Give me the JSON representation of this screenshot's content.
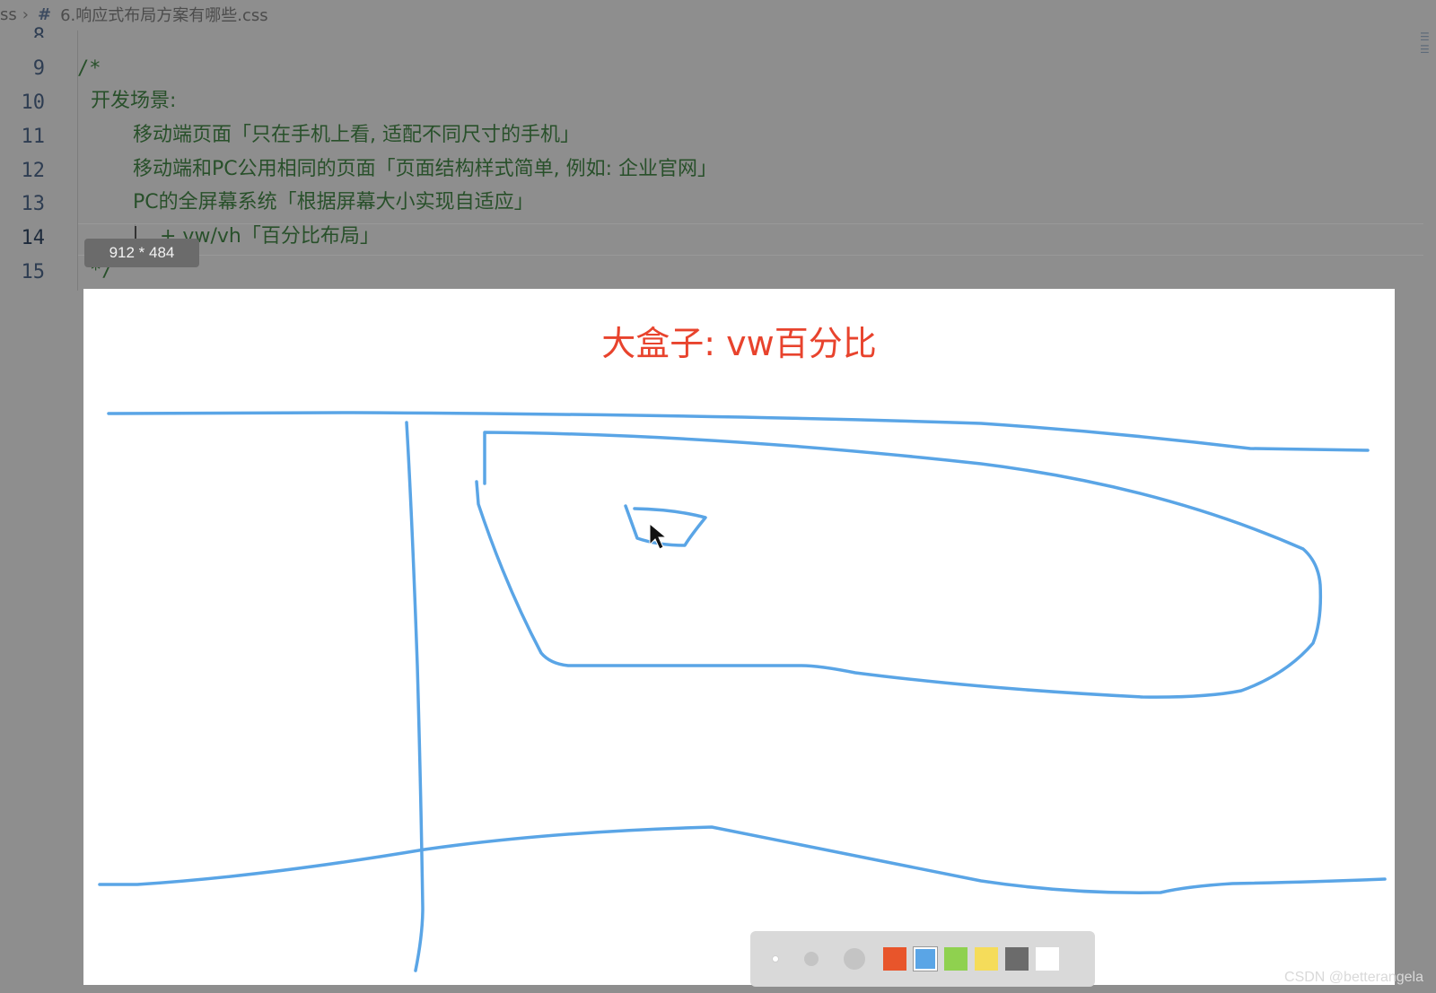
{
  "breadcrumb": {
    "parent": "ss",
    "file_icon": "#",
    "file_name": "6.响应式布局方案有哪些.css"
  },
  "editor": {
    "lines": [
      {
        "number": "8",
        "text": ""
      },
      {
        "number": "9",
        "text": "/*"
      },
      {
        "number": "10",
        "text": "开发场景:"
      },
      {
        "number": "11",
        "text": "移动端页面「只在手机上看, 适配不同尺寸的手机」"
      },
      {
        "number": "12",
        "text": "移动端和PC公用相同的页面「页面结构样式简单, 例如: 企业官网」"
      },
      {
        "number": "13",
        "text": "PC的全屏幕系统「根据屏幕大小实现自适应」"
      },
      {
        "number": "14",
        "text": "+ vw/vh「百分比布局」"
      },
      {
        "number": "15",
        "text": "*/"
      }
    ],
    "active_line": "14"
  },
  "tooltip": {
    "size": "912 * 484"
  },
  "whiteboard": {
    "title": "大盒子: vw百分比",
    "stroke_color": "#5aa5e6",
    "title_color": "#e8432d"
  },
  "toolbar": {
    "brushes": [
      "brush-small",
      "brush-medium",
      "brush-large"
    ],
    "colors": [
      "#e8552b",
      "#5aa5e6",
      "#8fd14f",
      "#f5dc5a",
      "#6b6b6b",
      "#ffffff"
    ],
    "selected_color": "#5aa5e6"
  },
  "watermark": "CSDN @betterangela"
}
